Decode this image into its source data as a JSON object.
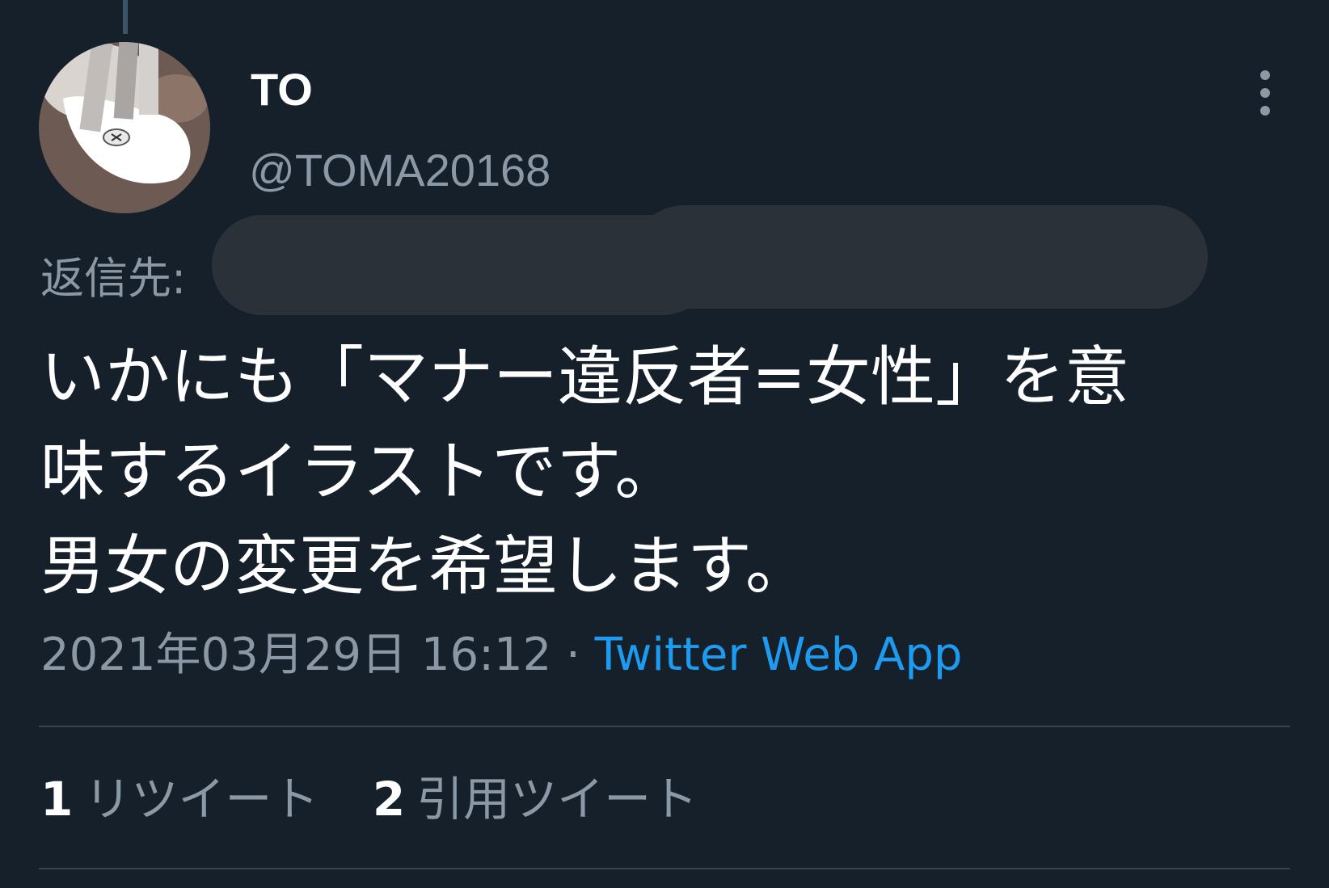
{
  "colors": {
    "background": "#15202b",
    "primary_text": "#ffffff",
    "secondary_text": "#8b98a5",
    "link": "#1d9bf0",
    "divider": "#38444d",
    "redaction": "#2a3139"
  },
  "tweet": {
    "author": {
      "display_name": "TO",
      "handle": "@TOMA20168"
    },
    "more_icon": "vertical-ellipsis-icon",
    "reply_label": "返信先:",
    "text_lines": [
      "いかにも「マナー違反者=女性」を意",
      "味するイラストです。",
      "男女の変更を希望します。"
    ],
    "timestamp": "2021年03月29日 16:12",
    "separator": "·",
    "source": "Twitter Web App",
    "stats": {
      "retweets": {
        "count": "1",
        "label": "リツイート"
      },
      "quotes": {
        "count": "2",
        "label": "引用ツイート"
      }
    }
  }
}
